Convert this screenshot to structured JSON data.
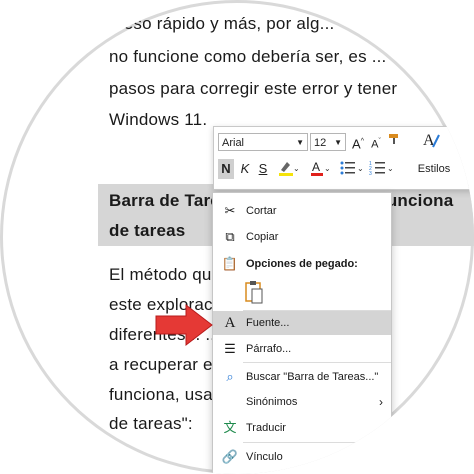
{
  "document": {
    "lines": [
      "...eso rápido y más, por alg...",
      "no funcione como debería ser, es ...",
      "pasos para corregir este error y tener",
      "Windows 11."
    ],
    "heading_line1": "Barra de Tareas Windows 11 No Funciona",
    "heading_line2": "de tareas",
    "body_lines": [
      "El método qu... ...ando el p",
      "este explorac... ...stionar e",
      "diferentes... ...ivo de",
      "a recuperar e... ...barra",
      "funciona, usa... ...Alt",
      "de tareas\":"
    ]
  },
  "toolbar": {
    "font_name": "Arial",
    "font_size": "12",
    "bold": "N",
    "italic": "K",
    "underline": "S",
    "styles_label": "Estilos"
  },
  "context_menu": {
    "cut": "Cortar",
    "copy": "Copiar",
    "paste_options": "Opciones de pegado:",
    "font": "Fuente...",
    "paragraph": "Párrafo...",
    "search": "Buscar \"Barra de Tareas...\"",
    "synonyms": "Sinónimos",
    "translate": "Traducir",
    "link": "Vínculo"
  },
  "colors": {
    "arrow": "#e53935",
    "highlight": "#d4d4d4",
    "heading_bg": "#d6d6d6"
  }
}
